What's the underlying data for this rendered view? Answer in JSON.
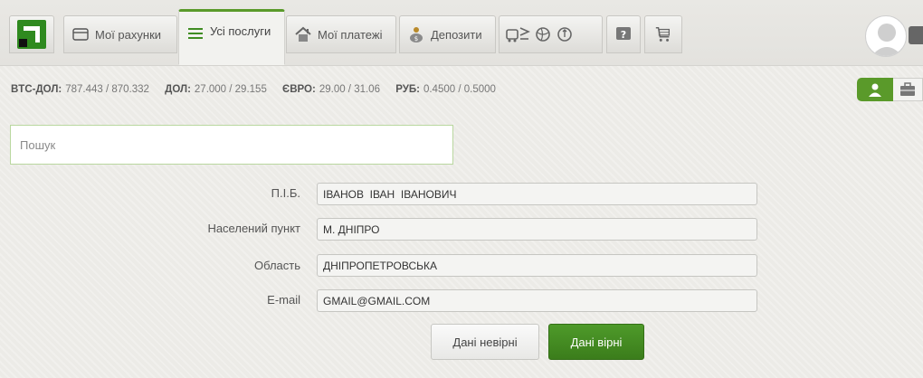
{
  "tabs": [
    {
      "label": "",
      "icon": "privat-logo-icon"
    },
    {
      "label": "Мої рахунки",
      "icon": "card-icon"
    },
    {
      "label": "Усі послуги",
      "icon": "list-icon",
      "active": true
    },
    {
      "label": "Мої платежі",
      "icon": "house-icon"
    },
    {
      "label": "Депозити",
      "icon": "money-bag-icon"
    }
  ],
  "rates": [
    {
      "name": "BTC-ДОЛ:",
      "value": "787.443 / 870.332"
    },
    {
      "name": "ДОЛ:",
      "value": "27.000 / 29.155"
    },
    {
      "name": "ЄВРО:",
      "value": "29.00 / 31.06"
    },
    {
      "name": "РУБ:",
      "value": "0.4500 / 0.5000"
    }
  ],
  "search": {
    "placeholder": "Пошук"
  },
  "form": {
    "fields": [
      {
        "label": "П.І.Б.",
        "value": "ІВАНОВ  ІВАН  ІВАНОВИЧ"
      },
      {
        "label": "Населений пункт",
        "value": "М. ДНІПРО"
      },
      {
        "label": "Область",
        "value": "ДНІПРОПЕТРОВСЬКА"
      },
      {
        "label": "E-mail",
        "value": "GMAIL@GMAIL.COM"
      }
    ],
    "btn_wrong": "Дані невірні",
    "btn_right": "Дані вірні"
  },
  "colors": {
    "accent": "#5a9a2a",
    "button_green": "#3b7d1b"
  }
}
